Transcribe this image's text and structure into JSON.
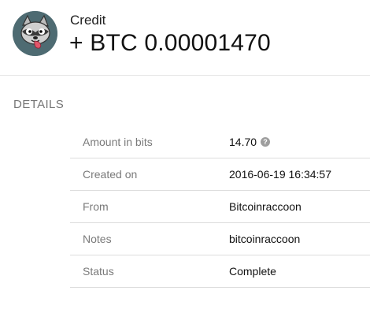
{
  "transaction": {
    "type": "Credit",
    "amount": "+ BTC 0.00001470"
  },
  "details": {
    "title": "DETAILS",
    "rows": [
      {
        "label": "Amount in bits",
        "value": "14.70"
      },
      {
        "label": "Created on",
        "value": "2016-06-19 16:34:57"
      },
      {
        "label": "From",
        "value": "Bitcoinraccoon"
      },
      {
        "label": "Notes",
        "value": "bitcoinraccoon"
      },
      {
        "label": "Status",
        "value": "Complete"
      }
    ]
  },
  "icons": {
    "avatar": "raccoon-avatar-icon",
    "info": "info-icon"
  },
  "colors": {
    "avatar_bg": "#4e6b72",
    "label": "#7a7a7a",
    "value": "#111111",
    "divider": "#dddddd"
  }
}
